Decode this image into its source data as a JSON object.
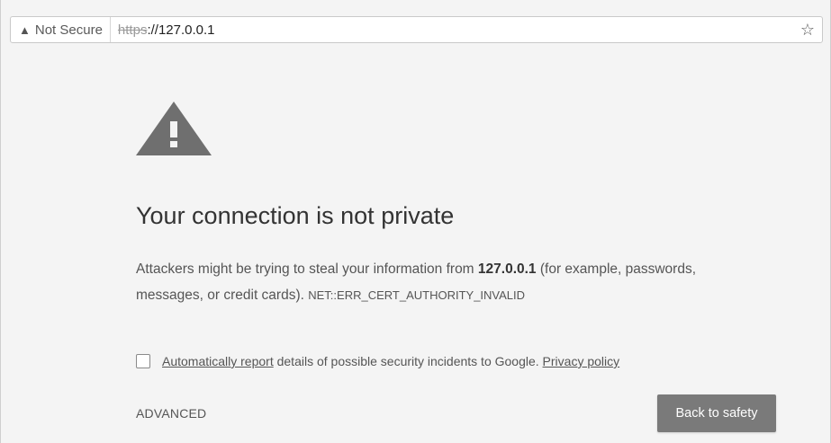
{
  "address_bar": {
    "security_label": "Not Secure",
    "url_scheme": "https",
    "url_rest": "://127.0.0.1"
  },
  "interstitial": {
    "heading": "Your connection is not private",
    "desc_prefix": "Attackers might be trying to steal your information from ",
    "host": "127.0.0.1",
    "desc_suffix": " (for example, passwords, messages, or credit cards). ",
    "error_code": "NET::ERR_CERT_AUTHORITY_INVALID",
    "report_link": "Automatically report",
    "report_text": " details of possible security incidents to Google. ",
    "privacy_link": "Privacy policy",
    "advanced_label": "ADVANCED",
    "back_button": "Back to safety"
  },
  "icons": {
    "address_warning": "warning-triangle-icon",
    "bookmark": "star-icon",
    "page_warning": "warning-triangle-icon"
  },
  "colors": {
    "page_bg": "#f4f4f4",
    "button_bg": "#7a7a7a",
    "warning_icon": "#6f6f6f"
  }
}
